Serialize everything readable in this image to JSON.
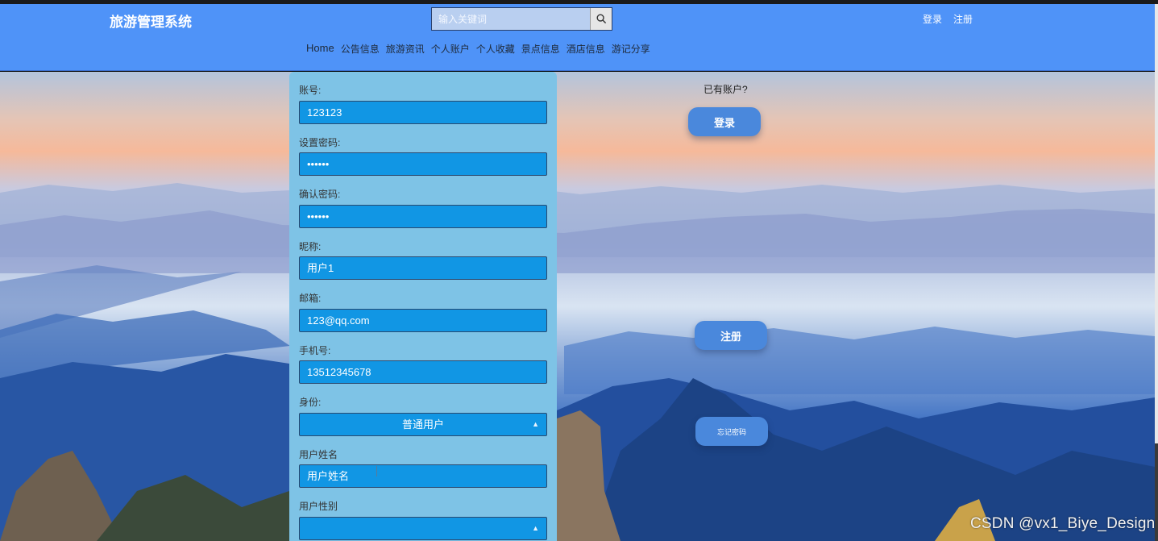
{
  "header": {
    "brand": "旅游管理系统",
    "search_placeholder": "输入关键词",
    "auth": [
      "登录",
      "注册"
    ],
    "nav": [
      "Home",
      "公告信息",
      "旅游资讯",
      "个人账户",
      "个人收藏",
      "景点信息",
      "酒店信息",
      "游记分享"
    ]
  },
  "form": {
    "fields": [
      {
        "label": "账号:",
        "value": "123123"
      },
      {
        "label": "设置密码:",
        "value": "••••••"
      },
      {
        "label": "确认密码:",
        "value": "••••••"
      },
      {
        "label": "昵称:",
        "value": "用户1"
      },
      {
        "label": "邮箱:",
        "value": "123@qq.com"
      },
      {
        "label": "手机号:",
        "value": "13512345678"
      },
      {
        "label": "身份:",
        "value": "普通用户"
      },
      {
        "label": "用户姓名",
        "value": "用户姓名"
      },
      {
        "label": "用户性别",
        "value": ""
      }
    ]
  },
  "side": {
    "have_account": "已有账户?",
    "login_button": "登录",
    "register_button": "注册",
    "forgot_button": "忘记密码"
  },
  "watermark": "CSDN @vx1_Biye_Design",
  "colors": {
    "header": "#4f93f8",
    "card": "#7ec3e6",
    "input": "#1196e4",
    "pill": "#4a88dc"
  }
}
